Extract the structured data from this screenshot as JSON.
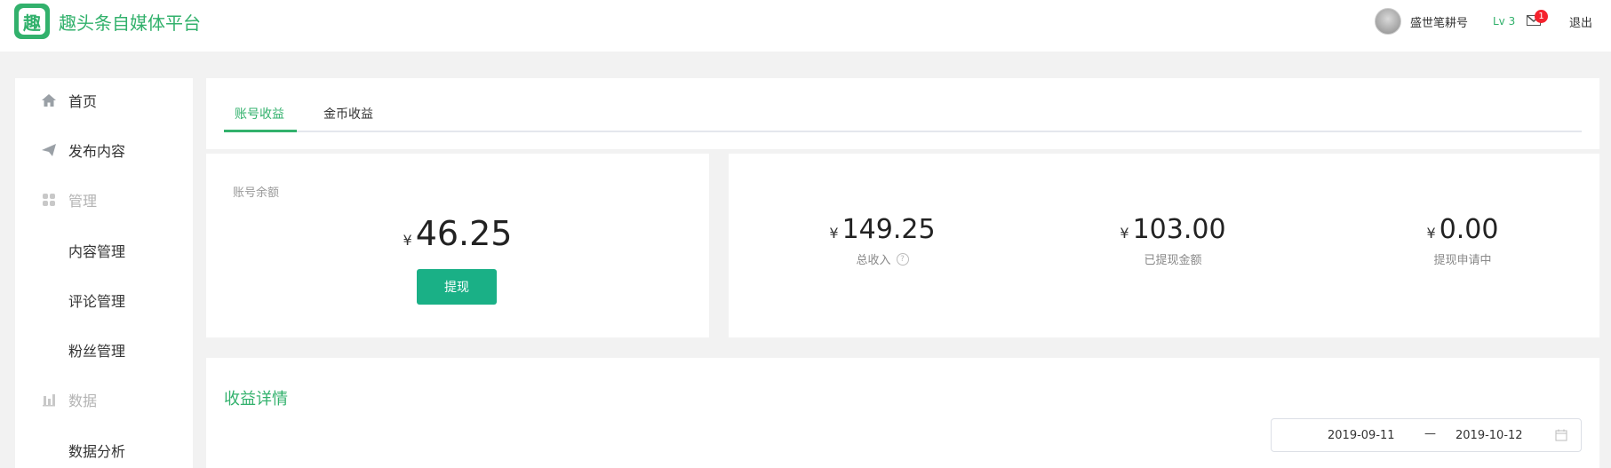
{
  "header": {
    "logo_char": "趣",
    "brand": "趣头条自媒体平台",
    "username": "盛世笔耕号",
    "level": "Lv 3",
    "mail_badge": "1",
    "logout": "退出"
  },
  "sidebar": {
    "items": [
      {
        "label": "首页",
        "icon": "home-icon",
        "type": "item"
      },
      {
        "label": "发布内容",
        "icon": "send-icon",
        "type": "item"
      },
      {
        "label": "管理",
        "icon": "grid-icon",
        "type": "group"
      },
      {
        "label": "内容管理",
        "type": "sub"
      },
      {
        "label": "评论管理",
        "type": "sub"
      },
      {
        "label": "粉丝管理",
        "type": "sub"
      },
      {
        "label": "数据",
        "icon": "bar-chart-icon",
        "type": "group"
      },
      {
        "label": "数据分析",
        "type": "sub"
      }
    ]
  },
  "tabs": [
    {
      "label": "账号收益",
      "active": true
    },
    {
      "label": "金币收益",
      "active": false
    }
  ],
  "balance": {
    "label": "账号余额",
    "currency": "¥",
    "amount": "46.25",
    "withdraw": "提现"
  },
  "stats": [
    {
      "currency": "¥",
      "value": "149.25",
      "caption": "总收入",
      "help": "?"
    },
    {
      "currency": "¥",
      "value": "103.00",
      "caption": "已提现金额"
    },
    {
      "currency": "¥",
      "value": "0.00",
      "caption": "提现申请中"
    }
  ],
  "detail": {
    "title": "收益详情",
    "date_start": "2019-09-11",
    "date_separator": "—",
    "date_end": "2019-10-12"
  },
  "colors": {
    "accent": "#32b16c",
    "button": "#1ab086",
    "badge": "#f5222d",
    "background": "#f2f2f2"
  }
}
